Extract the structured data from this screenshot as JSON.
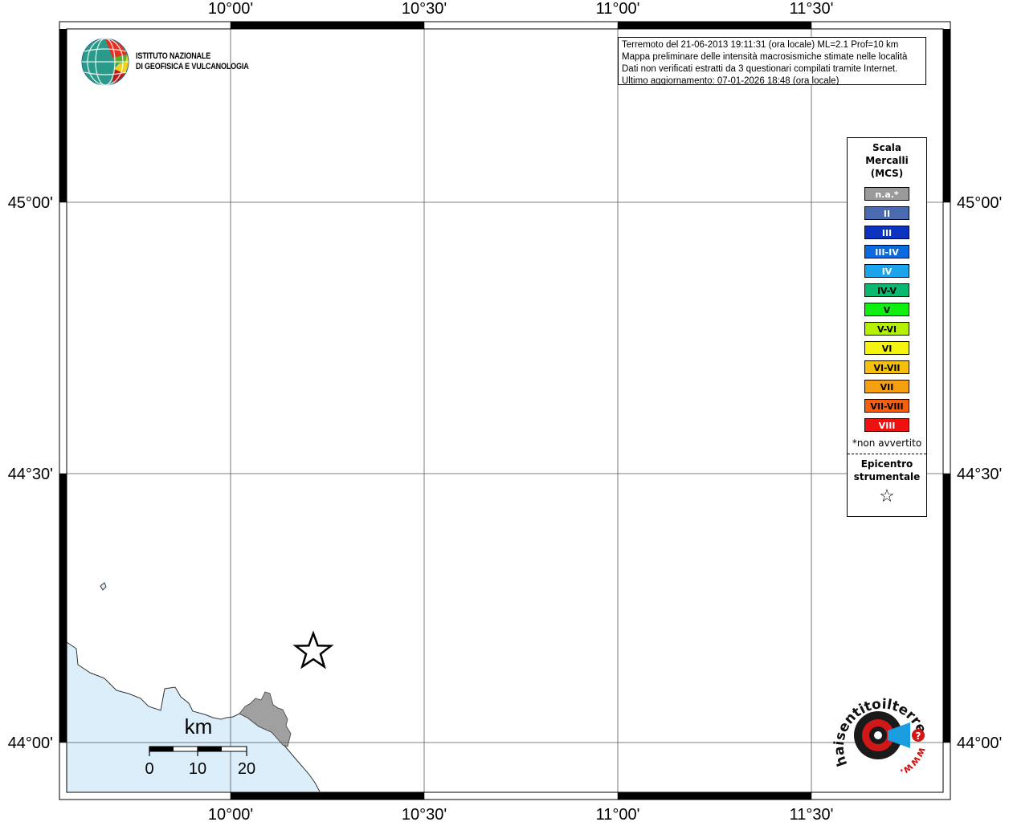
{
  "map": {
    "lon_labels": [
      "10°00'",
      "10°30'",
      "11°00'",
      "11°30'"
    ],
    "lat_labels": [
      "45°00'",
      "44°30'",
      "44°00'"
    ]
  },
  "info": {
    "line1": "Terremoto del 21-06-2013 19:11:31 (ora locale) ML=2.1 Prof=10 km",
    "line2": "Mappa preliminare delle intensità macrosismiche stimate nelle località",
    "line3": "Dati non verificati estratti da 3 questionari compilati tramite Internet.",
    "line4": "Ultimo aggiornamento: 07-01-2026 18:48 (ora locale)"
  },
  "legend": {
    "title_1": "Scala",
    "title_2": "Mercalli",
    "title_3": "(MCS)",
    "items": [
      {
        "label": "n.a.*",
        "color": "#9a9a9a",
        "text_color": "#ffffff"
      },
      {
        "label": "II",
        "color": "#4a6bb0",
        "text_color": "#ffffff"
      },
      {
        "label": "III",
        "color": "#0a34c0",
        "text_color": "#ffffff"
      },
      {
        "label": "III-IV",
        "color": "#0a6ae0",
        "text_color": "#ffffff"
      },
      {
        "label": "IV",
        "color": "#1aa4ec",
        "text_color": "#ffffff"
      },
      {
        "label": "IV-V",
        "color": "#0ab870",
        "text_color": "#000000"
      },
      {
        "label": "V",
        "color": "#10f010",
        "text_color": "#000000"
      },
      {
        "label": "V-VI",
        "color": "#b4f000",
        "text_color": "#000000"
      },
      {
        "label": "VI",
        "color": "#f4f410",
        "text_color": "#000000"
      },
      {
        "label": "VI-VII",
        "color": "#f4c010",
        "text_color": "#000000"
      },
      {
        "label": "VII",
        "color": "#f4a010",
        "text_color": "#000000"
      },
      {
        "label": "VII-VIII",
        "color": "#f46010",
        "text_color": "#000000"
      },
      {
        "label": "VIII",
        "color": "#f01010",
        "text_color": "#ffffff"
      }
    ],
    "note": "*non avvertito",
    "epicenter_1": "Epicentro",
    "epicenter_2": "strumentale"
  },
  "scale_bar": {
    "unit": "km",
    "ticks": [
      "0",
      "10",
      "20"
    ]
  },
  "ingv": {
    "line1": "ISTITUTO NAZIONALE",
    "line2": "DI GEOFISICA E VULCANOLOGIA"
  },
  "hs_logo": {
    "text": "haisentitoilterremoto.it",
    "url_text": "www."
  },
  "colors": {
    "sea": "#dceefa",
    "land_highlight": "#a0a0a0",
    "grid": "#555555"
  }
}
